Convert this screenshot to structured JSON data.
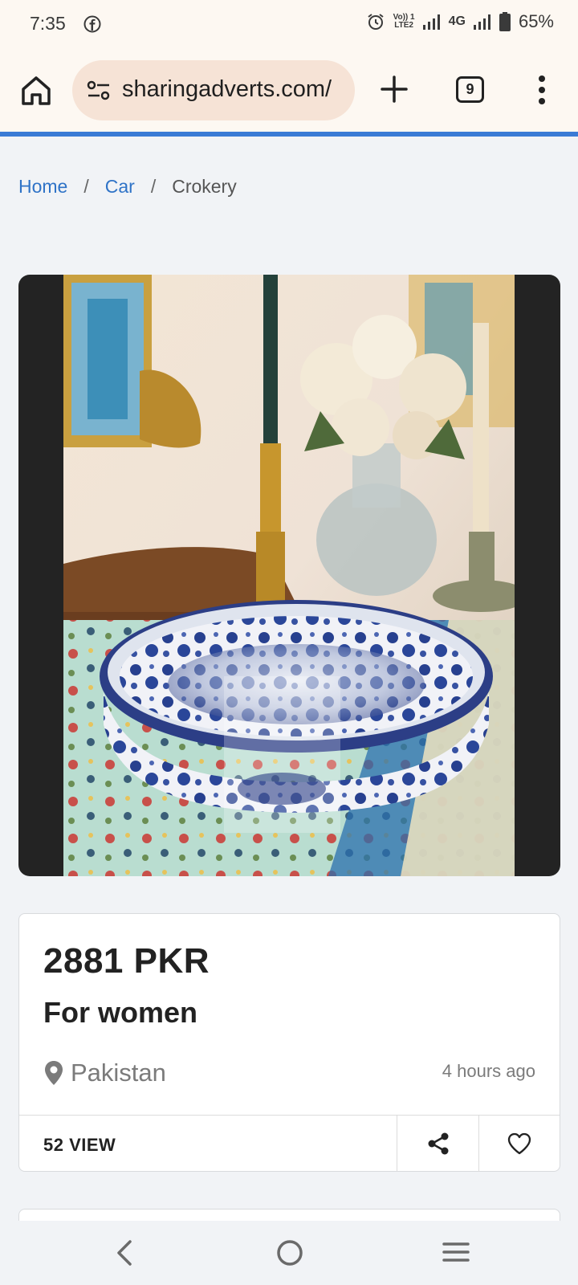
{
  "status_bar": {
    "time": "7:35",
    "network_label": "4G",
    "volte_line1": "Vo)) 1",
    "volte_line2": "LTE2",
    "battery_percent": "65%"
  },
  "browser": {
    "url": "sharingadverts.com/",
    "tab_count": "9",
    "accent_color": "#3a7bd5"
  },
  "breadcrumb": {
    "items": [
      {
        "label": "Home"
      },
      {
        "label": "Car"
      },
      {
        "label": "Crokery"
      }
    ],
    "separator": "/"
  },
  "listing": {
    "price": "2881 PKR",
    "title": "For women",
    "location": "Pakistan",
    "posted": "4 hours ago",
    "views": "52 VIEW"
  },
  "icons": {
    "status": [
      "facebook-icon",
      "alarm-icon",
      "signal-icon",
      "battery-icon"
    ],
    "toolbar": [
      "home-icon",
      "site-settings-icon",
      "plus-icon",
      "tabs-icon",
      "more-vert-icon"
    ],
    "card": [
      "location-pin-icon",
      "share-icon",
      "heart-icon"
    ],
    "nav": [
      "back-icon",
      "home-circle-icon",
      "recents-icon"
    ]
  }
}
